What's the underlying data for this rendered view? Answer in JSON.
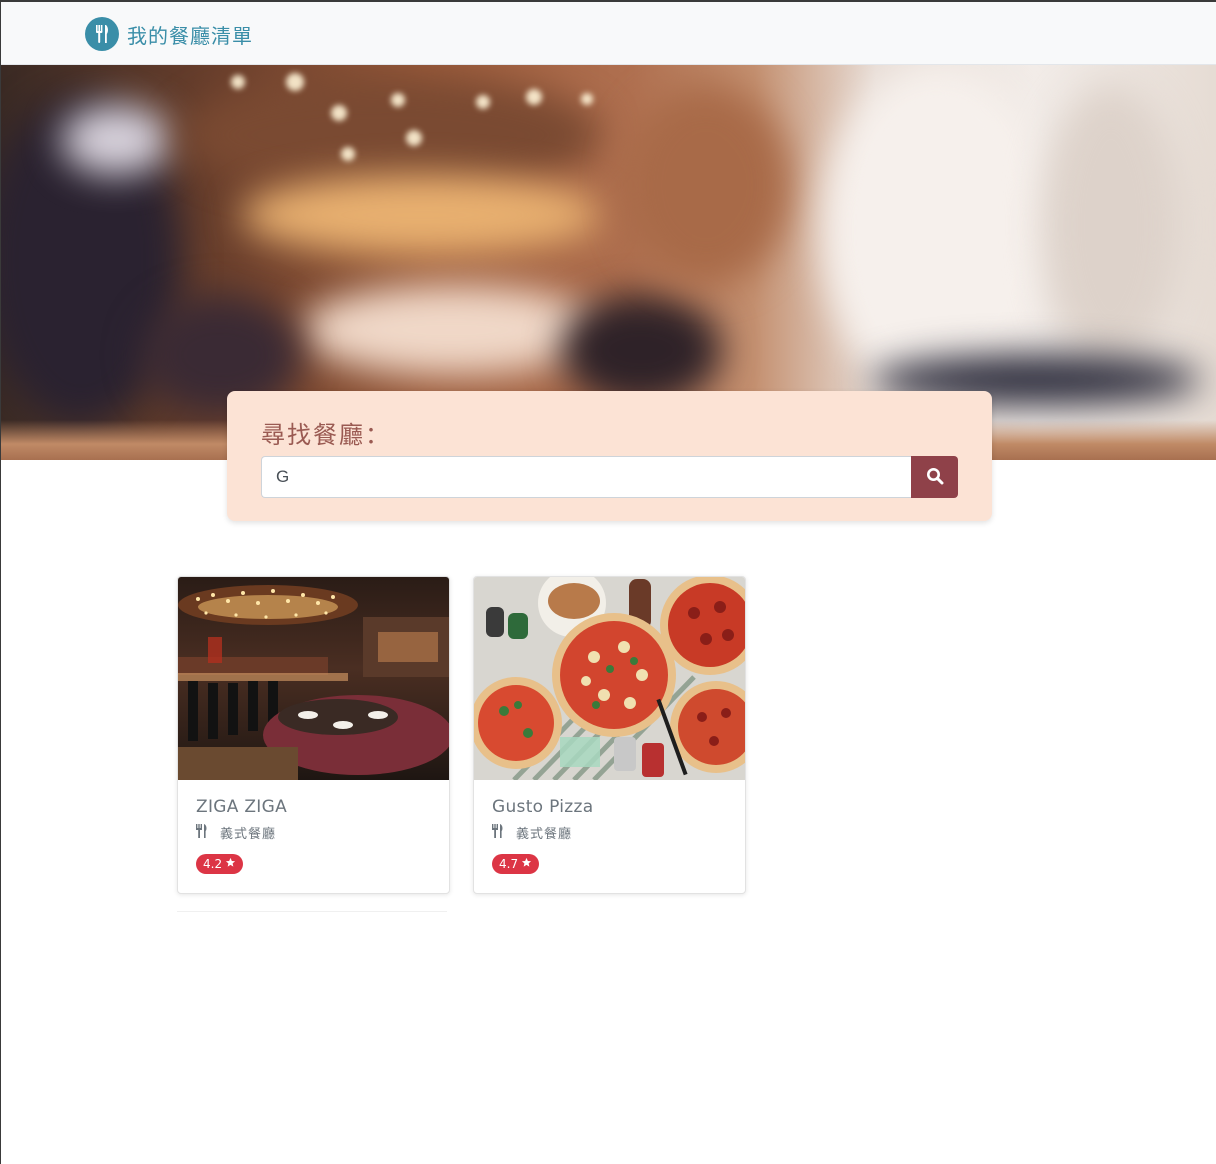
{
  "navbar": {
    "brand_title": "我的餐廳清單",
    "brand_icon": "utensils-icon"
  },
  "colors": {
    "brand": "#3a8ea8",
    "search_panel": "#fce3d5",
    "search_button": "#8f4149",
    "rating_badge": "#dc3545"
  },
  "search": {
    "heading": "尋找餐廳：",
    "value": "G",
    "button_icon": "search-icon"
  },
  "restaurants": [
    {
      "name": "ZIGA ZIGA",
      "category": "義式餐廳",
      "category_icon": "utensils-icon",
      "rating": "4.2",
      "rating_icon": "star-icon",
      "image": "restaurant interior photo"
    },
    {
      "name": "Gusto Pizza",
      "category": "義式餐廳",
      "category_icon": "utensils-icon",
      "rating": "4.7",
      "rating_icon": "star-icon",
      "image": "pizza photo"
    }
  ]
}
